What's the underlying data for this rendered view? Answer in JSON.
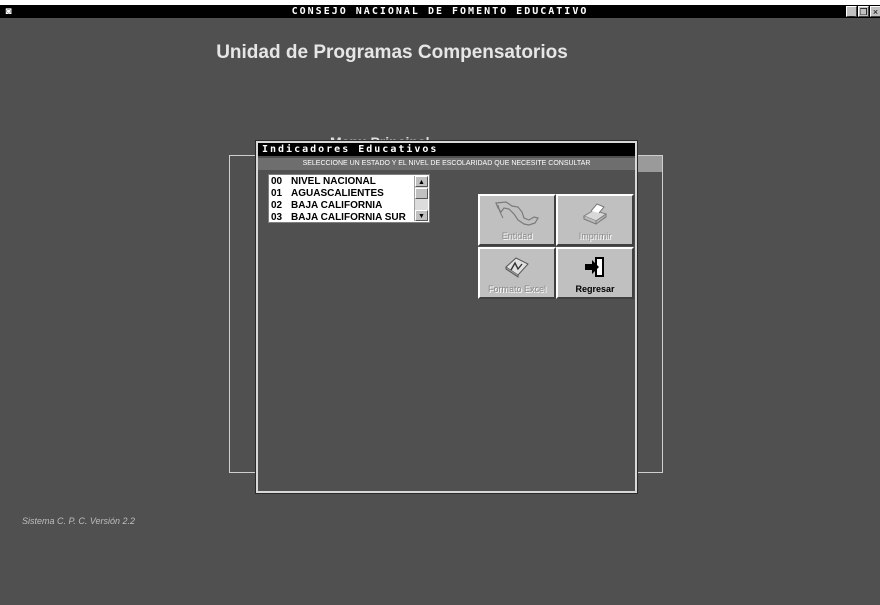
{
  "window": {
    "title": "CONSEJO NACIONAL DE FOMENTO EDUCATIVO",
    "minimize": "_",
    "restore": "❐",
    "close": "×"
  },
  "app": {
    "title": "Unidad de Programas Compensatorios",
    "version": "Sistema C. P. C. Versión 2.2",
    "menu_title": "Menu Principal"
  },
  "dialog": {
    "title": "Indicadores Educativos",
    "instruction": "SELECCIONE UN ESTADO Y EL NIVEL DE ESCOLARIDAD QUE NECESITE CONSULTAR",
    "list": [
      {
        "code": "00",
        "name": "NIVEL NACIONAL"
      },
      {
        "code": "01",
        "name": "AGUASCALIENTES"
      },
      {
        "code": "02",
        "name": "BAJA CALIFORNIA"
      },
      {
        "code": "03",
        "name": "BAJA CALIFORNIA SUR"
      }
    ],
    "buttons": {
      "entidad": "Entidad",
      "imprimir": "Imprimir",
      "excel": "Formato Excel",
      "regresar": "Regresar"
    }
  }
}
